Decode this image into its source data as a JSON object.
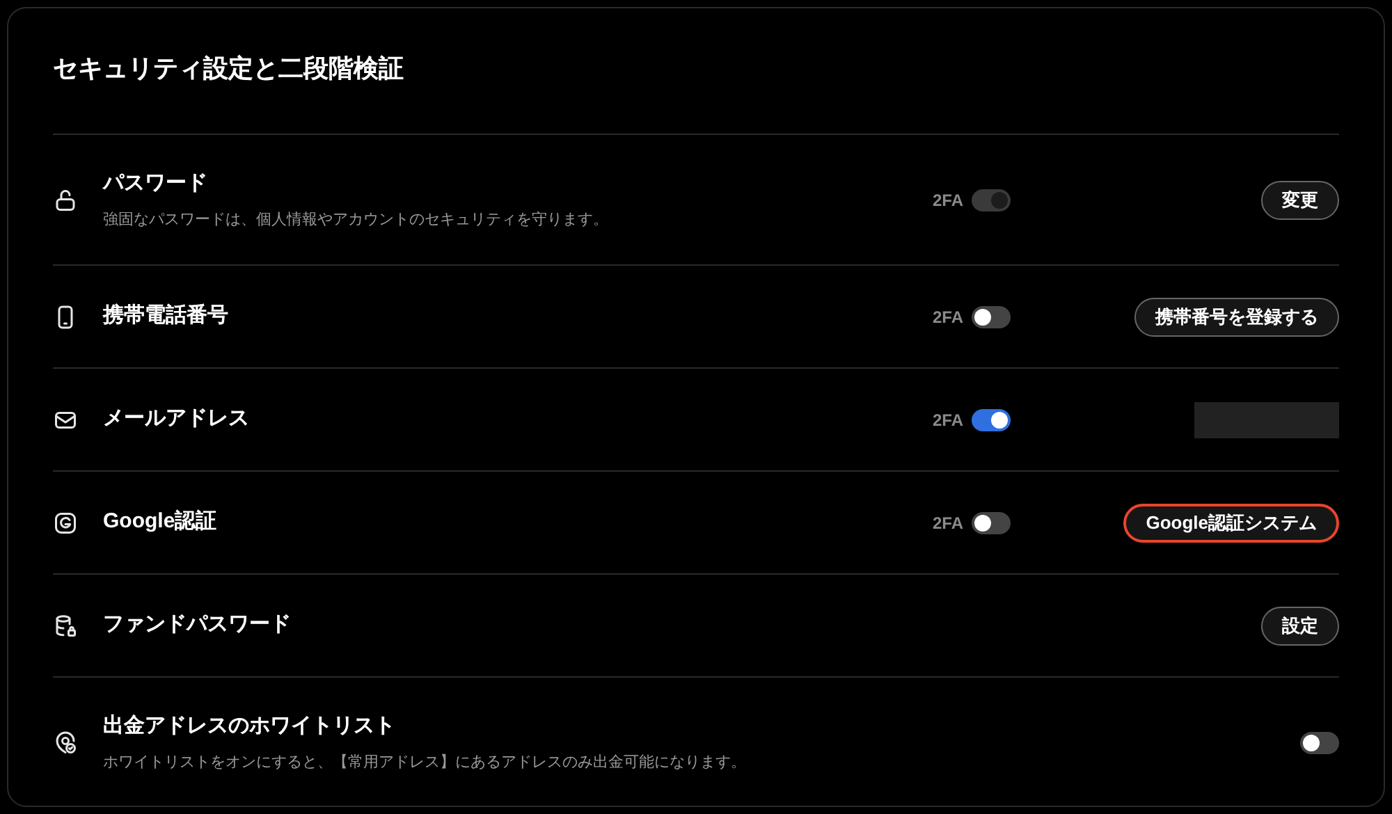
{
  "title": "セキュリティ設定と二段階検証",
  "rows": [
    {
      "kind": "lock",
      "label": "パスワード",
      "description": "強固なパスワードは、個人情報やアカウントのセキュリティを守ります。",
      "twofa": {
        "label": "2FA",
        "on": true,
        "disabled": true
      },
      "action": {
        "kind": "button",
        "label": "変更",
        "highlighted": false
      }
    },
    {
      "kind": "phone",
      "label": "携帯電話番号",
      "twofa": {
        "label": "2FA",
        "on": false,
        "disabled": false
      },
      "action": {
        "kind": "button",
        "label": "携帯番号を登録する",
        "highlighted": false
      }
    },
    {
      "kind": "mail",
      "label": "メールアドレス",
      "twofa": {
        "label": "2FA",
        "on": true,
        "disabled": false
      },
      "action": {
        "kind": "redacted"
      }
    },
    {
      "kind": "google",
      "label": "Google認証",
      "twofa": {
        "label": "2FA",
        "on": false,
        "disabled": false
      },
      "action": {
        "kind": "button",
        "label": "Google認証システム",
        "highlighted": true
      }
    },
    {
      "kind": "database",
      "label": "ファンドパスワード",
      "action": {
        "kind": "button",
        "label": "設定",
        "highlighted": false
      }
    },
    {
      "kind": "whitelist",
      "label": "出金アドレスのホワイトリスト",
      "description": "ホワイトリストをオンにすると、【常用アドレス】にあるアドレスのみ出金可能になります。",
      "action": {
        "kind": "toggle",
        "on": false,
        "disabled": false
      }
    }
  ]
}
